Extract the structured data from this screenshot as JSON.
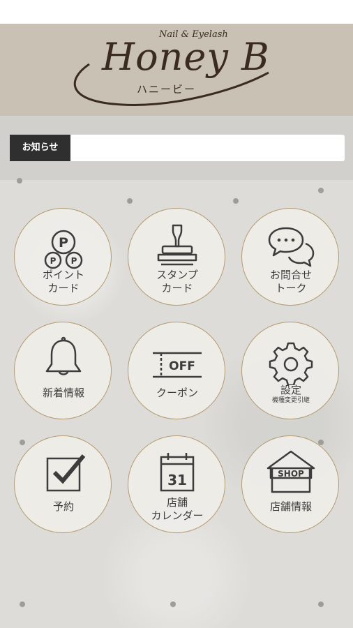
{
  "header": {
    "logo_sub": "Nail & Eyelash",
    "logo_main": "Honey B",
    "logo_kana": "ハニービー"
  },
  "notice": {
    "label": "お知らせ",
    "text": ""
  },
  "menu": [
    {
      "icon": "point-card-icon",
      "line1": "ポイント",
      "line2": "カード"
    },
    {
      "icon": "stamp-icon",
      "line1": "スタンプ",
      "line2": "カード"
    },
    {
      "icon": "chat-icon",
      "line1": "お問合せ",
      "line2": "トーク"
    },
    {
      "icon": "bell-icon",
      "line1": "新着情報",
      "line2": ""
    },
    {
      "icon": "coupon-icon",
      "line1": "クーポン",
      "line2": "",
      "badge": "OFF"
    },
    {
      "icon": "gear-icon",
      "line1": "設定",
      "line2": "機種変更引継"
    },
    {
      "icon": "checkbox-icon",
      "line1": "予約",
      "line2": ""
    },
    {
      "icon": "calendar-icon",
      "line1": "店舗",
      "line2": "カレンダー",
      "badge": "31"
    },
    {
      "icon": "shop-icon",
      "line1": "店舗情報",
      "line2": "",
      "badge": "SHOP"
    }
  ]
}
